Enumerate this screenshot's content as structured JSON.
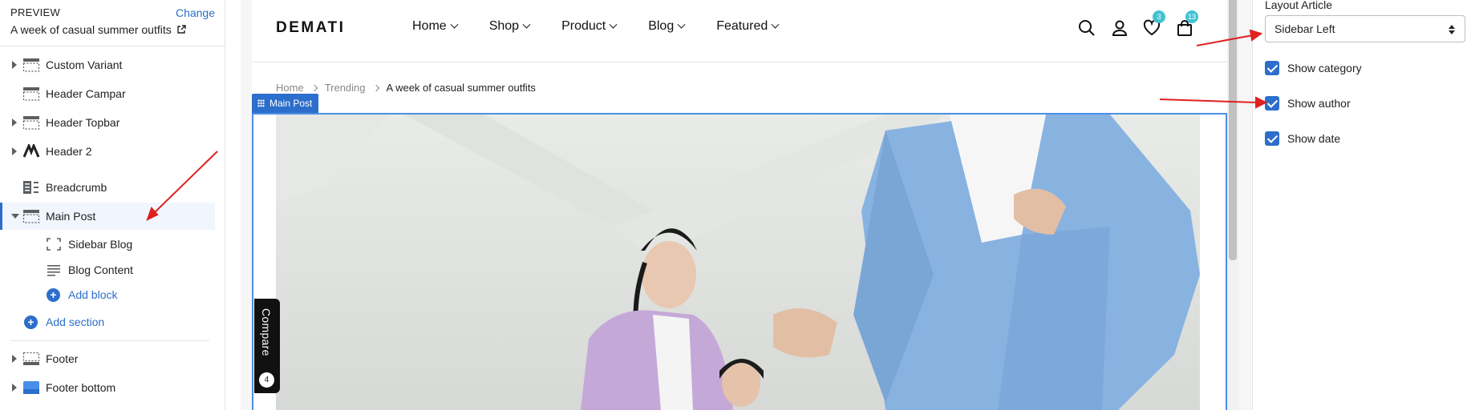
{
  "preview": {
    "label": "PREVIEW",
    "change": "Change",
    "title": "A week of casual summer outfits"
  },
  "sections": [
    {
      "label": "Custom Variant"
    },
    {
      "label": "Header Campar"
    },
    {
      "label": "Header Topbar"
    },
    {
      "label": "Header 2"
    },
    {
      "label": "Breadcrumb"
    },
    {
      "label": "Main Post"
    },
    {
      "label": "Footer"
    },
    {
      "label": "Footer bottom"
    }
  ],
  "blocks": [
    {
      "label": "Sidebar Blog"
    },
    {
      "label": "Blog Content"
    }
  ],
  "add_block": "Add block",
  "add_section": "Add section",
  "site": {
    "logo": "DEMATI",
    "nav": [
      "Home",
      "Shop",
      "Product",
      "Blog",
      "Featured"
    ],
    "wishlist_count": "3",
    "cart_count": "13",
    "breadcrumb": [
      "Home",
      "Trending",
      "A week of casual summer outfits"
    ],
    "section_tag": "Main Post",
    "compare_label": "Compare",
    "compare_count": "4"
  },
  "settings": {
    "layout_label": "Layout Article",
    "layout_value": "Sidebar Left",
    "options": [
      {
        "label": "Show category",
        "checked": true
      },
      {
        "label": "Show author",
        "checked": true
      },
      {
        "label": "Show date",
        "checked": true
      }
    ]
  },
  "colors": {
    "accent": "#2c6ecb",
    "annotation": "#e02020",
    "badge": "#42c2d2"
  }
}
